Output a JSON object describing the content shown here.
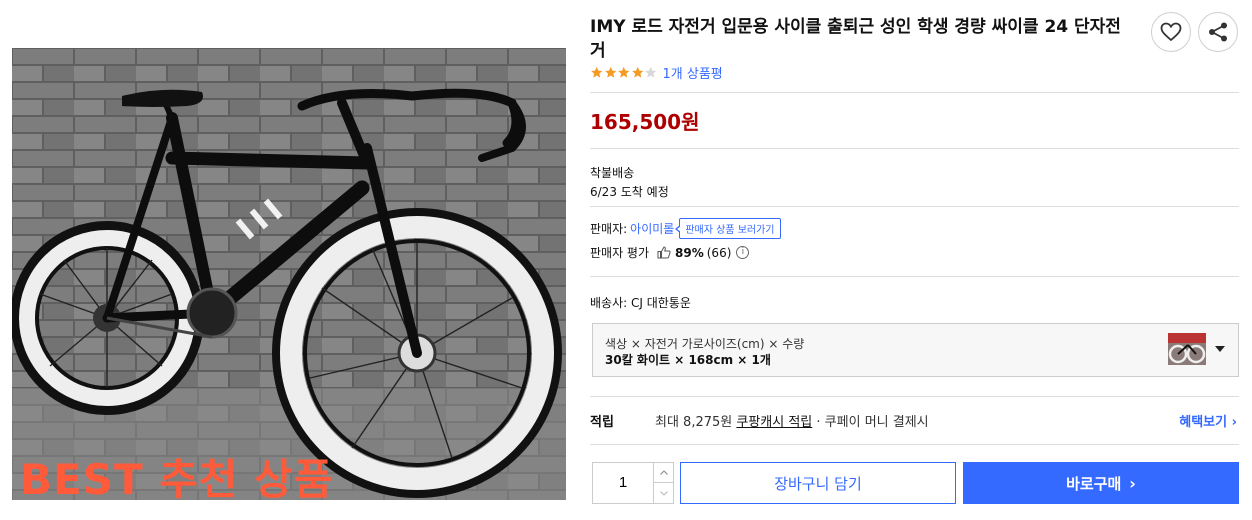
{
  "product": {
    "title": "IMY 로드 자전거 입문용 사이클 출퇴근 성인 학생 경량 싸이클 24 단자전거",
    "image_overlay_text": "BEST 추천 상품",
    "rating_value": 4,
    "rating_max": 5,
    "review_link": "1개 상품평",
    "price": "165,500원"
  },
  "shipping": {
    "type": "착불배송",
    "arrival": "6/23 도착 예정",
    "carrier": "배송사: CJ 대한통운"
  },
  "seller": {
    "label": "판매자:",
    "name": "아이미롤",
    "tooltip": "판매자 상품 보러가기",
    "eval_label": "판매자 평가",
    "eval_pct": "89%",
    "eval_count": "(66)"
  },
  "option": {
    "label": "색상 × 자전거 가로사이즈(cm) × 수량",
    "value": "30칼 화이트 × 168cm × 1개"
  },
  "reward": {
    "label": "적립",
    "text_prefix": "최대 8,275원 ",
    "text_link": "쿠팡캐시 적립",
    "text_suffix": " · 쿠페이 머니 결제시",
    "benefit_link": "혜택보기 ›"
  },
  "purchase": {
    "quantity": "1",
    "cart_label": "장바구니 담기",
    "buy_label": "바로구매",
    "buy_chevron": "›"
  },
  "colors": {
    "accent": "#346aff",
    "price": "#ae0000",
    "star": "#f59a23",
    "overlay_text": "#ff5b3b"
  },
  "icons": {
    "heart": "heart-icon",
    "share": "share-icon",
    "thumb": "thumbs-up-icon",
    "info": "info-icon"
  }
}
